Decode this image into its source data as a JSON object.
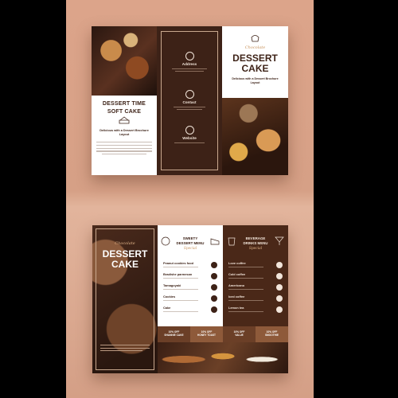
{
  "top_brochure": {
    "panel1": {
      "title_line1": "DESSERT TIME",
      "title_line2": "SOFT CAKE",
      "tagline": "Delicious with a Dessert Brochure Layout"
    },
    "panel2": {
      "address_label": "Address",
      "contact_label": "Contact",
      "website_label": "Website"
    },
    "panel3": {
      "script": "Chocolate",
      "title_line1": "DESSERT",
      "title_line2": "CAKE",
      "tagline": "Delicious with a Dessert Brochure Layout"
    }
  },
  "bottom_brochure": {
    "panel1": {
      "script": "Chocolate",
      "title_line1": "DESSERT",
      "title_line2": "CAKE"
    },
    "panel2": {
      "heading_line1": "SWEETY",
      "heading_line2": "DESSERT MENU",
      "script": "Special",
      "items": [
        {
          "name": "Peanut cookies food"
        },
        {
          "name": "Bradishe parmesan"
        },
        {
          "name": "Tamagoyaki"
        },
        {
          "name": "Cookies"
        },
        {
          "name": "Cake"
        }
      ]
    },
    "panel3": {
      "heading_line1": "BEVERAGE",
      "heading_line2": "DRINKS MENU",
      "script": "Special",
      "items": [
        {
          "name": "Love coffee"
        },
        {
          "name": "Cold coffee"
        },
        {
          "name": "Americano"
        },
        {
          "name": "Iced coffee"
        },
        {
          "name": "Lemon tea"
        }
      ]
    },
    "promos": [
      {
        "line1": "10% OFF",
        "line2": "SHANNIE CAKE",
        "color": "#6b3f27"
      },
      {
        "line1": "10% OFF",
        "line2": "HONEY TOAST",
        "color": "#8e5a3a"
      },
      {
        "line1": "10% OFF",
        "line2": "VALUE",
        "color": "#6b3f27"
      },
      {
        "line1": "10% OFF",
        "line2": "SMOOTHIE",
        "color": "#8e5a3a"
      }
    ]
  },
  "colors": {
    "brown_dark": "#3d2217",
    "accent": "#c8925b",
    "background": "#d6a086"
  }
}
